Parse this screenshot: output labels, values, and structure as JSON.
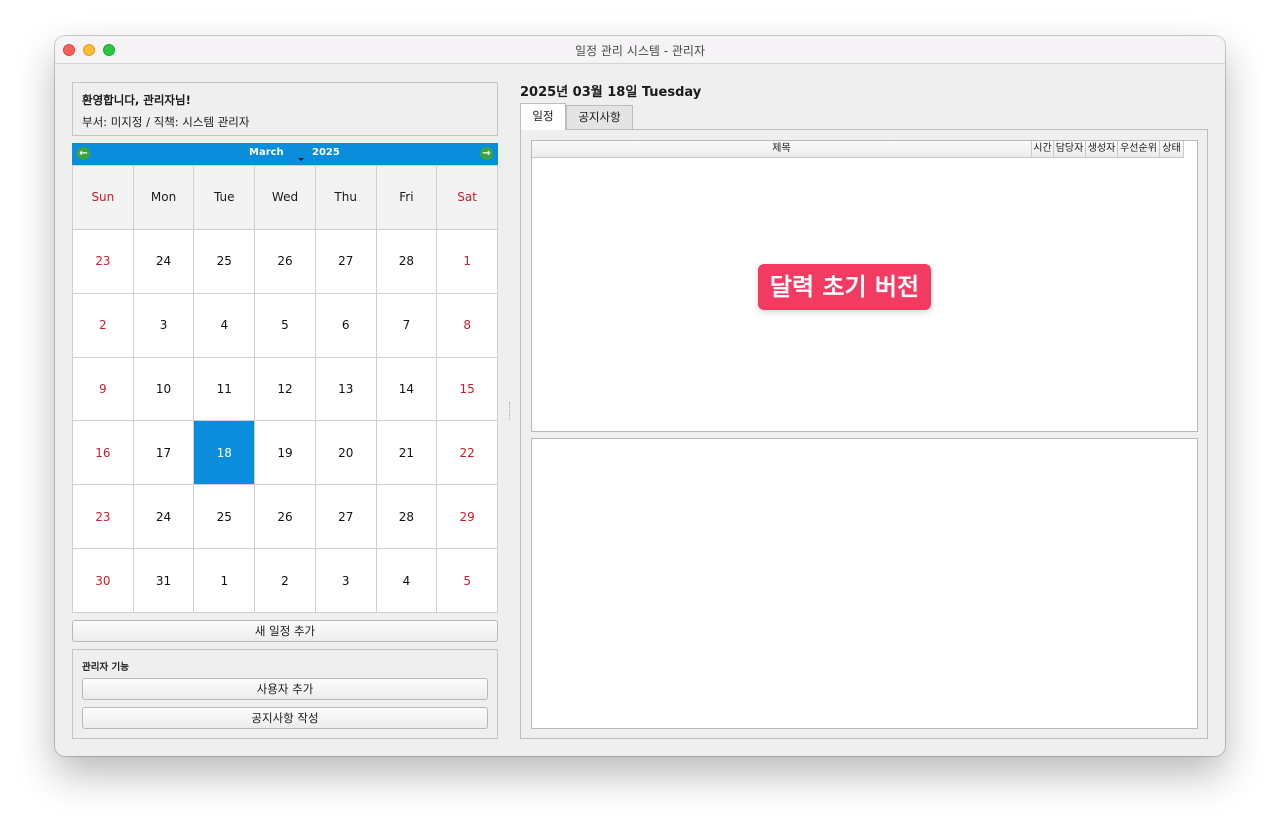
{
  "window": {
    "title": "일정 관리 시스템 - 관리자"
  },
  "welcome": {
    "title": "환영합니다, 관리자님!",
    "subtitle": "부서: 미지정 / 직책: 시스템 관리자"
  },
  "calendar": {
    "month": "March",
    "year": "2025",
    "weekdays": [
      "Sun",
      "Mon",
      "Tue",
      "Wed",
      "Thu",
      "Fri",
      "Sat"
    ],
    "weeks": [
      [
        "23",
        "24",
        "25",
        "26",
        "27",
        "28",
        "1"
      ],
      [
        "2",
        "3",
        "4",
        "5",
        "6",
        "7",
        "8"
      ],
      [
        "9",
        "10",
        "11",
        "12",
        "13",
        "14",
        "15"
      ],
      [
        "16",
        "17",
        "18",
        "19",
        "20",
        "21",
        "22"
      ],
      [
        "23",
        "24",
        "25",
        "26",
        "27",
        "28",
        "29"
      ],
      [
        "30",
        "31",
        "1",
        "2",
        "3",
        "4",
        "5"
      ]
    ],
    "selected_day": "18",
    "colors": {
      "header": "#0a8ddb",
      "selected": "#0a8ddb",
      "weekend": "#d21a2a"
    }
  },
  "buttons": {
    "add_schedule": "새 일정 추가"
  },
  "admin": {
    "title": "관리자 기능",
    "add_user": "사용자 추가",
    "write_notice": "공지사항 작성"
  },
  "main": {
    "date_title": "2025년 03월 18일 Tuesday",
    "tabs": [
      "일정",
      "공지사항"
    ],
    "active_tab": "일정",
    "columns": [
      "제목",
      "시간",
      "담당자",
      "생성자",
      "우선순위",
      "상태"
    ]
  },
  "overlay": {
    "label": "달력 초기 버전",
    "color": "#f33a61"
  }
}
